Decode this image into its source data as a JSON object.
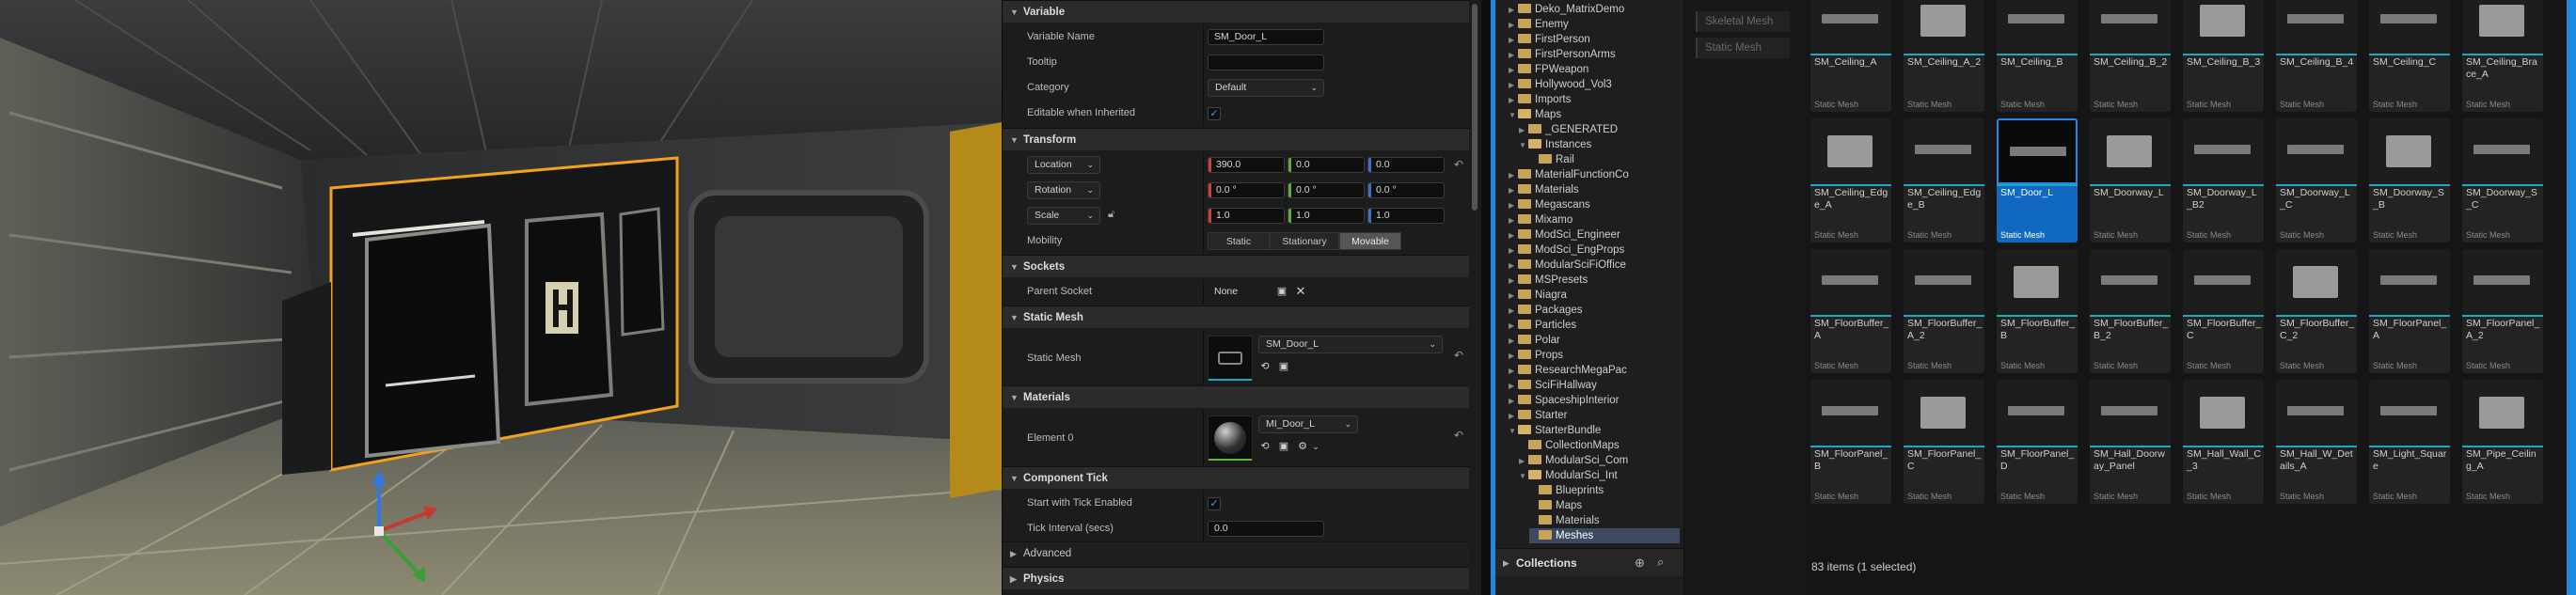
{
  "details": {
    "sections": {
      "variable": "Variable",
      "transform": "Transform",
      "sockets": "Sockets",
      "static_mesh": "Static Mesh",
      "materials": "Materials",
      "component_tick": "Component Tick",
      "advanced": "Advanced",
      "physics": "Physics"
    },
    "variable_name_label": "Variable Name",
    "variable_name_value": "SM_Door_L",
    "tooltip_label": "Tooltip",
    "tooltip_value": "",
    "category_label": "Category",
    "category_value": "Default",
    "editable_label": "Editable when Inherited",
    "location_label": "Location",
    "rotation_label": "Rotation",
    "scale_label": "Scale",
    "location": [
      "390.0",
      "0.0",
      "0.0"
    ],
    "rotation": [
      "0.0 °",
      "0.0 °",
      "0.0 °"
    ],
    "scale": [
      "1.0",
      "1.0",
      "1.0"
    ],
    "mobility_label": "Mobility",
    "mobility_options": [
      "Static",
      "Stationary",
      "Movable"
    ],
    "mobility_selected": "Movable",
    "parent_socket_label": "Parent Socket",
    "parent_socket_value": "None",
    "static_mesh_label": "Static Mesh",
    "static_mesh_value": "SM_Door_L",
    "element0_label": "Element 0",
    "element0_value": "MI_Door_L",
    "tick_enabled_label": "Start with Tick Enabled",
    "tick_interval_label": "Tick Interval (secs)",
    "tick_interval_value": "0.0"
  },
  "tree": {
    "items": [
      {
        "label": "Deko_MatrixDemo",
        "indent": 1,
        "open": false,
        "arrow": true
      },
      {
        "label": "Enemy",
        "indent": 1,
        "open": false,
        "arrow": true
      },
      {
        "label": "FirstPerson",
        "indent": 1,
        "open": false,
        "arrow": true
      },
      {
        "label": "FirstPersonArms",
        "indent": 1,
        "open": false,
        "arrow": true
      },
      {
        "label": "FPWeapon",
        "indent": 1,
        "open": false,
        "arrow": true
      },
      {
        "label": "Hollywood_Vol3",
        "indent": 1,
        "open": false,
        "arrow": true
      },
      {
        "label": "Imports",
        "indent": 1,
        "open": false,
        "arrow": true
      },
      {
        "label": "Maps",
        "indent": 1,
        "open": true,
        "arrow": true
      },
      {
        "label": "_GENERATED",
        "indent": 2,
        "open": false,
        "arrow": true
      },
      {
        "label": "Instances",
        "indent": 2,
        "open": true,
        "arrow": true
      },
      {
        "label": "Rail",
        "indent": 3,
        "open": false,
        "arrow": false
      },
      {
        "label": "MaterialFunctionCo",
        "indent": 1,
        "open": false,
        "arrow": true
      },
      {
        "label": "Materials",
        "indent": 1,
        "open": false,
        "arrow": true
      },
      {
        "label": "Megascans",
        "indent": 1,
        "open": false,
        "arrow": true
      },
      {
        "label": "Mixamo",
        "indent": 1,
        "open": false,
        "arrow": true
      },
      {
        "label": "ModSci_Engineer",
        "indent": 1,
        "open": false,
        "arrow": true
      },
      {
        "label": "ModSci_EngProps",
        "indent": 1,
        "open": false,
        "arrow": true
      },
      {
        "label": "ModularSciFiOffice",
        "indent": 1,
        "open": false,
        "arrow": true
      },
      {
        "label": "MSPresets",
        "indent": 1,
        "open": false,
        "arrow": true
      },
      {
        "label": "Niagra",
        "indent": 1,
        "open": false,
        "arrow": true
      },
      {
        "label": "Packages",
        "indent": 1,
        "open": false,
        "arrow": true
      },
      {
        "label": "Particles",
        "indent": 1,
        "open": false,
        "arrow": true
      },
      {
        "label": "Polar",
        "indent": 1,
        "open": false,
        "arrow": true
      },
      {
        "label": "Props",
        "indent": 1,
        "open": false,
        "arrow": true
      },
      {
        "label": "ResearchMegaPac",
        "indent": 1,
        "open": false,
        "arrow": true
      },
      {
        "label": "SciFiHallway",
        "indent": 1,
        "open": false,
        "arrow": true
      },
      {
        "label": "SpaceshipInterior",
        "indent": 1,
        "open": false,
        "arrow": true
      },
      {
        "label": "Starter",
        "indent": 1,
        "open": false,
        "arrow": true
      },
      {
        "label": "StarterBundle",
        "indent": 1,
        "open": true,
        "arrow": true
      },
      {
        "label": "CollectionMaps",
        "indent": 2,
        "open": false,
        "arrow": false
      },
      {
        "label": "ModularSci_Com",
        "indent": 2,
        "open": false,
        "arrow": true
      },
      {
        "label": "ModularSci_Int",
        "indent": 2,
        "open": true,
        "arrow": true
      },
      {
        "label": "Blueprints",
        "indent": 3,
        "open": false,
        "arrow": false
      },
      {
        "label": "Maps",
        "indent": 3,
        "open": false,
        "arrow": false
      },
      {
        "label": "Materials",
        "indent": 3,
        "open": false,
        "arrow": false
      },
      {
        "label": "Meshes",
        "indent": 3,
        "open": false,
        "arrow": false,
        "selected": true
      }
    ],
    "collections_label": "Collections"
  },
  "filters": [
    "Skeletal Mesh",
    "Static Mesh"
  ],
  "assets": {
    "type_label": "Static Mesh",
    "rows": [
      [
        "SM_Ceiling_A",
        "SM_Ceiling_A_2",
        "SM_Ceiling_B",
        "SM_Ceiling_B_2",
        "SM_Ceiling_B_3",
        "SM_Ceiling_B_4",
        "SM_Ceiling_C",
        "SM_Ceiling_Brace_A"
      ],
      [
        "SM_Ceiling_Edge_A",
        "SM_Ceiling_Edge_B",
        "SM_Door_L",
        "SM_Doorway_L",
        "SM_Doorway_L_B2",
        "SM_Doorway_L_C",
        "SM_Doorway_S_B",
        "SM_Doorway_S_C"
      ],
      [
        "SM_FloorBuffer_A",
        "SM_FloorBuffer_A_2",
        "SM_FloorBuffer_B",
        "SM_FloorBuffer_B_2",
        "SM_FloorBuffer_C",
        "SM_FloorBuffer_C_2",
        "SM_FloorPanel_A",
        "SM_FloorPanel_A_2"
      ],
      [
        "SM_FloorPanel_B",
        "SM_FloorPanel_C",
        "SM_FloorPanel_D",
        "SM_Hall_Doorway_Panel",
        "SM_Hall_Wall_C_3",
        "SM_Hall_W_Details_A",
        "SM_Light_Square",
        "SM_Pipe_Ceiling_A"
      ]
    ],
    "selected": "SM_Door_L",
    "status": "83 items (1 selected)"
  },
  "colors": {
    "accent": "#1a8be0",
    "selection_outline": "#f2a31a",
    "tile_bar": "#1aa7c8"
  }
}
